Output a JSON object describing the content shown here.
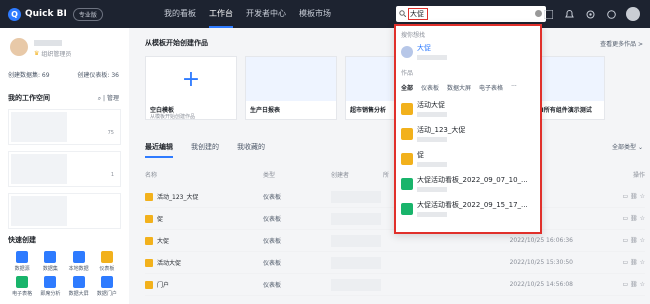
{
  "brand": {
    "name": "Quick BI",
    "edition": "专业版"
  },
  "nav": [
    "我的看板",
    "工作台",
    "开发者中心",
    "模板市场"
  ],
  "search": {
    "value": "大促"
  },
  "profile": {
    "role": "组织管理员",
    "stats": [
      "创建数据集: 69",
      "创建仪表板: 36"
    ]
  },
  "workspace": {
    "title": "我的工作空间",
    "manage": "管理",
    "cards": [
      {
        "count": "75"
      },
      {
        "count": "1"
      },
      {
        "count": ""
      }
    ]
  },
  "quick": {
    "title": "快速创建",
    "items": [
      "数据源",
      "数据集",
      "本地数据",
      "仪表板",
      "电子表格",
      "即席分析",
      "数据大屏",
      "数据门户"
    ]
  },
  "templates": {
    "title": "从模板开始创建作品",
    "more": "查看更多作品 >",
    "items": [
      {
        "name": "空白模板",
        "sub": "从模板开始创建作品"
      },
      {
        "name": "生产日报表",
        "sub": ""
      },
      {
        "name": "超市销售分析",
        "sub": ""
      },
      {
        "name": "",
        "sub": ""
      },
      {
        "name": "QuickBI所有组件演示测试",
        "sub": ""
      }
    ]
  },
  "tabs": [
    "最近编辑",
    "我创建的",
    "我收藏的"
  ],
  "filter": "全部类型",
  "table": {
    "headers": [
      "名称",
      "类型",
      "创建者",
      "所",
      "",
      "操作"
    ],
    "rows": [
      {
        "name": "活动_123_大促",
        "type": "仪表板",
        "time": ""
      },
      {
        "name": "促",
        "type": "仪表板",
        "time": ""
      },
      {
        "name": "大促",
        "type": "仪表板",
        "time": "2022/10/25 16:06:36"
      },
      {
        "name": "活动大促",
        "type": "仪表板",
        "time": "2022/10/25 15:30:50"
      },
      {
        "name": "门户",
        "type": "仪表板",
        "time": "2022/10/25 14:56:08"
      }
    ]
  },
  "dropdown": {
    "user_label": "搜你想找",
    "user": "大促",
    "works_label": "作品",
    "tabs": [
      "全部",
      "仪表板",
      "数据大屏",
      "电子表格",
      "···"
    ],
    "items": [
      "活动大促",
      "活动_123_大促",
      "促",
      "大促活动看板_2022_09_07_10_...",
      "大促活动看板_2022_09_15_17_..."
    ]
  }
}
